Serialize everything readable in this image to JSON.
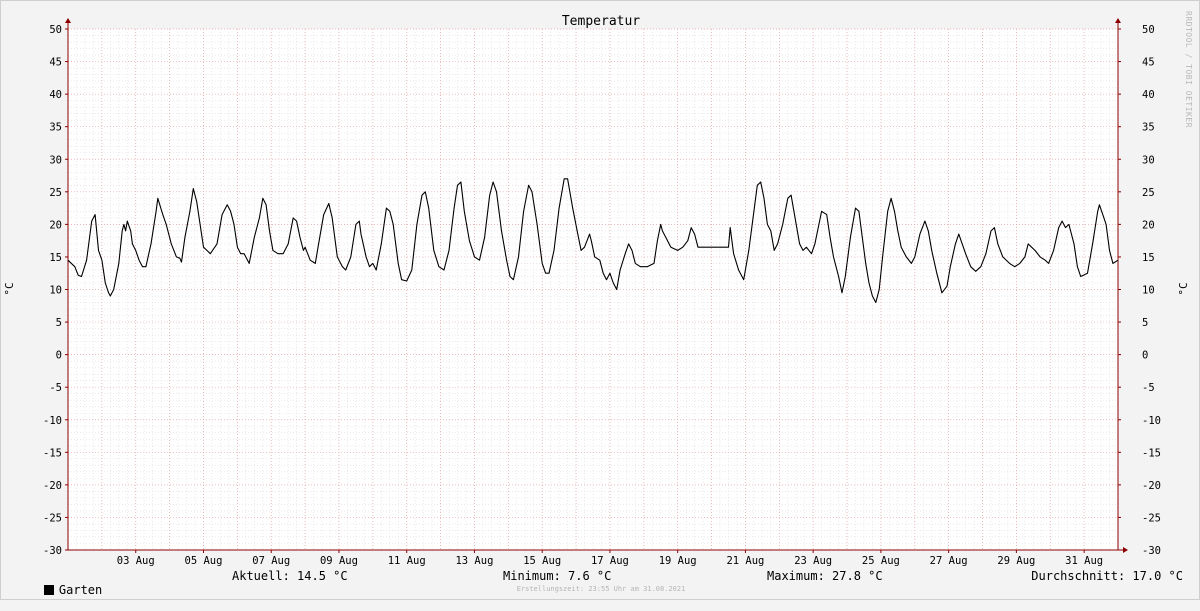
{
  "chart_data": {
    "type": "line",
    "title": "Temperatur",
    "ylabel": "°C",
    "ylabel_right": "°C",
    "ylim": [
      -30,
      50
    ],
    "y_ticks": [
      50,
      45,
      40,
      35,
      30,
      25,
      20,
      15,
      10,
      5,
      0,
      -5,
      -10,
      -15,
      -20,
      -25,
      -30
    ],
    "x_range_day": [
      1.0,
      32.0
    ],
    "x_tick_labels": [
      "03 Aug",
      "05 Aug",
      "07 Aug",
      "09 Aug",
      "11 Aug",
      "13 Aug",
      "15 Aug",
      "17 Aug",
      "19 Aug",
      "21 Aug",
      "23 Aug",
      "25 Aug",
      "27 Aug",
      "29 Aug",
      "31 Aug"
    ],
    "x_tick_days": [
      3,
      5,
      7,
      9,
      11,
      13,
      15,
      17,
      19,
      21,
      23,
      25,
      27,
      29,
      31
    ],
    "grid": true,
    "legend": "bottom-left",
    "series": [
      {
        "name": "Garten",
        "color": "#000000",
        "points": [
          [
            1.0,
            14.5
          ],
          [
            1.2,
            13.5
          ],
          [
            1.3,
            12.2
          ],
          [
            1.4,
            12.0
          ],
          [
            1.55,
            14.5
          ],
          [
            1.7,
            20.5
          ],
          [
            1.8,
            21.5
          ],
          [
            1.9,
            16.0
          ],
          [
            2.0,
            14.5
          ],
          [
            2.1,
            11.0
          ],
          [
            2.2,
            9.5
          ],
          [
            2.25,
            9.0
          ],
          [
            2.35,
            10.0
          ],
          [
            2.5,
            14.0
          ],
          [
            2.6,
            19.0
          ],
          [
            2.65,
            20.0
          ],
          [
            2.7,
            19.0
          ],
          [
            2.75,
            20.5
          ],
          [
            2.85,
            19.0
          ],
          [
            2.9,
            17.0
          ],
          [
            3.0,
            16.0
          ],
          [
            3.1,
            14.5
          ],
          [
            3.2,
            13.5
          ],
          [
            3.3,
            13.5
          ],
          [
            3.45,
            17.0
          ],
          [
            3.6,
            22.0
          ],
          [
            3.65,
            24.0
          ],
          [
            3.8,
            21.5
          ],
          [
            3.9,
            20.0
          ],
          [
            4.05,
            17.0
          ],
          [
            4.2,
            15.0
          ],
          [
            4.3,
            14.8
          ],
          [
            4.35,
            14.2
          ],
          [
            4.45,
            18.0
          ],
          [
            4.6,
            22.0
          ],
          [
            4.7,
            25.5
          ],
          [
            4.8,
            23.5
          ],
          [
            4.9,
            20.0
          ],
          [
            5.0,
            16.5
          ],
          [
            5.1,
            16.0
          ],
          [
            5.2,
            15.5
          ],
          [
            5.4,
            17.0
          ],
          [
            5.55,
            21.5
          ],
          [
            5.7,
            23.0
          ],
          [
            5.8,
            22.0
          ],
          [
            5.9,
            20.0
          ],
          [
            6.0,
            16.5
          ],
          [
            6.1,
            15.5
          ],
          [
            6.2,
            15.5
          ],
          [
            6.35,
            14.0
          ],
          [
            6.5,
            18.0
          ],
          [
            6.65,
            21.0
          ],
          [
            6.75,
            24.0
          ],
          [
            6.85,
            23.0
          ],
          [
            6.95,
            19.0
          ],
          [
            7.05,
            16.0
          ],
          [
            7.2,
            15.5
          ],
          [
            7.35,
            15.5
          ],
          [
            7.5,
            17.0
          ],
          [
            7.65,
            21.0
          ],
          [
            7.75,
            20.5
          ],
          [
            7.85,
            18.0
          ],
          [
            7.95,
            16.0
          ],
          [
            8.0,
            16.5
          ],
          [
            8.15,
            14.5
          ],
          [
            8.3,
            14.0
          ],
          [
            8.4,
            17.0
          ],
          [
            8.55,
            21.5
          ],
          [
            8.7,
            23.2
          ],
          [
            8.8,
            21.0
          ],
          [
            8.95,
            15.0
          ],
          [
            9.1,
            13.5
          ],
          [
            9.2,
            13.0
          ],
          [
            9.35,
            15.0
          ],
          [
            9.5,
            20.0
          ],
          [
            9.6,
            20.5
          ],
          [
            9.65,
            18.5
          ],
          [
            9.8,
            15.0
          ],
          [
            9.9,
            13.5
          ],
          [
            10.0,
            14.0
          ],
          [
            10.1,
            13.0
          ],
          [
            10.25,
            17.0
          ],
          [
            10.4,
            22.5
          ],
          [
            10.5,
            22.0
          ],
          [
            10.6,
            20.0
          ],
          [
            10.75,
            14.0
          ],
          [
            10.85,
            11.5
          ],
          [
            11.0,
            11.3
          ],
          [
            11.15,
            13.0
          ],
          [
            11.3,
            20.0
          ],
          [
            11.45,
            24.5
          ],
          [
            11.55,
            25.0
          ],
          [
            11.65,
            22.5
          ],
          [
            11.8,
            16.0
          ],
          [
            11.95,
            13.5
          ],
          [
            12.1,
            13.0
          ],
          [
            12.25,
            16.0
          ],
          [
            12.4,
            22.5
          ],
          [
            12.5,
            26.0
          ],
          [
            12.6,
            26.5
          ],
          [
            12.7,
            22.0
          ],
          [
            12.85,
            17.5
          ],
          [
            13.0,
            15.0
          ],
          [
            13.15,
            14.5
          ],
          [
            13.3,
            18.0
          ],
          [
            13.45,
            24.5
          ],
          [
            13.55,
            26.5
          ],
          [
            13.65,
            25.0
          ],
          [
            13.8,
            19.0
          ],
          [
            13.95,
            14.5
          ],
          [
            14.05,
            12.0
          ],
          [
            14.15,
            11.5
          ],
          [
            14.3,
            15.0
          ],
          [
            14.45,
            22.0
          ],
          [
            14.6,
            26.0
          ],
          [
            14.7,
            25.0
          ],
          [
            14.85,
            20.0
          ],
          [
            15.0,
            14.0
          ],
          [
            15.1,
            12.5
          ],
          [
            15.2,
            12.5
          ],
          [
            15.35,
            16.0
          ],
          [
            15.5,
            22.5
          ],
          [
            15.65,
            27.0
          ],
          [
            15.75,
            27.0
          ],
          [
            15.9,
            22.5
          ],
          [
            16.05,
            18.5
          ],
          [
            16.15,
            16.0
          ],
          [
            16.25,
            16.5
          ],
          [
            16.4,
            18.5
          ],
          [
            16.45,
            17.5
          ],
          [
            16.55,
            15.0
          ],
          [
            16.7,
            14.5
          ],
          [
            16.8,
            12.5
          ],
          [
            16.9,
            11.5
          ],
          [
            17.0,
            12.5
          ],
          [
            17.1,
            11.0
          ],
          [
            17.2,
            10.0
          ],
          [
            17.3,
            13.0
          ],
          [
            17.45,
            15.5
          ],
          [
            17.55,
            17.0
          ],
          [
            17.65,
            16.0
          ],
          [
            17.75,
            14.0
          ],
          [
            17.9,
            13.5
          ],
          [
            18.1,
            13.5
          ],
          [
            18.3,
            14.0
          ],
          [
            18.4,
            17.5
          ],
          [
            18.5,
            20.0
          ],
          [
            18.55,
            19.0
          ],
          [
            18.65,
            18.0
          ],
          [
            18.8,
            16.5
          ],
          [
            19.0,
            16.0
          ],
          [
            19.15,
            16.5
          ],
          [
            19.3,
            17.5
          ],
          [
            19.4,
            19.5
          ],
          [
            19.5,
            18.5
          ],
          [
            19.6,
            16.5
          ],
          [
            19.8,
            16.5
          ],
          [
            20.3,
            16.5
          ],
          [
            20.5,
            16.5
          ],
          [
            20.55,
            19.5
          ],
          [
            20.65,
            15.5
          ],
          [
            20.8,
            13.0
          ],
          [
            20.95,
            11.5
          ],
          [
            21.1,
            16.0
          ],
          [
            21.25,
            22.0
          ],
          [
            21.35,
            26.0
          ],
          [
            21.45,
            26.5
          ],
          [
            21.55,
            24.0
          ],
          [
            21.65,
            20.0
          ],
          [
            21.75,
            19.0
          ],
          [
            21.85,
            16.0
          ],
          [
            21.95,
            17.0
          ],
          [
            22.1,
            20.0
          ],
          [
            22.25,
            24.0
          ],
          [
            22.35,
            24.5
          ],
          [
            22.5,
            20.0
          ],
          [
            22.6,
            17.0
          ],
          [
            22.7,
            16.0
          ],
          [
            22.8,
            16.5
          ],
          [
            22.95,
            15.5
          ],
          [
            23.05,
            17.0
          ],
          [
            23.25,
            22.0
          ],
          [
            23.4,
            21.5
          ],
          [
            23.5,
            18.0
          ],
          [
            23.6,
            15.0
          ],
          [
            23.75,
            12.0
          ],
          [
            23.85,
            9.5
          ],
          [
            23.95,
            12.0
          ],
          [
            24.1,
            18.0
          ],
          [
            24.25,
            22.5
          ],
          [
            24.35,
            22.0
          ],
          [
            24.45,
            18.0
          ],
          [
            24.55,
            14.0
          ],
          [
            24.65,
            11.0
          ],
          [
            24.75,
            9.0
          ],
          [
            24.85,
            8.0
          ],
          [
            24.95,
            10.0
          ],
          [
            25.05,
            15.0
          ],
          [
            25.2,
            22.0
          ],
          [
            25.3,
            24.0
          ],
          [
            25.4,
            22.0
          ],
          [
            25.5,
            19.0
          ],
          [
            25.6,
            16.5
          ],
          [
            25.75,
            15.0
          ],
          [
            25.9,
            14.0
          ],
          [
            26.0,
            15.0
          ],
          [
            26.15,
            18.5
          ],
          [
            26.3,
            20.5
          ],
          [
            26.4,
            19.0
          ],
          [
            26.5,
            16.0
          ],
          [
            26.65,
            12.5
          ],
          [
            26.8,
            9.5
          ],
          [
            26.95,
            10.5
          ],
          [
            27.05,
            13.5
          ],
          [
            27.2,
            17.0
          ],
          [
            27.3,
            18.5
          ],
          [
            27.4,
            17.0
          ],
          [
            27.5,
            15.5
          ],
          [
            27.65,
            13.5
          ],
          [
            27.8,
            12.8
          ],
          [
            27.95,
            13.5
          ],
          [
            28.1,
            15.5
          ],
          [
            28.25,
            19.0
          ],
          [
            28.35,
            19.5
          ],
          [
            28.45,
            17.0
          ],
          [
            28.6,
            15.0
          ],
          [
            28.8,
            14.0
          ],
          [
            28.95,
            13.5
          ],
          [
            29.1,
            14.0
          ],
          [
            29.25,
            15.0
          ],
          [
            29.35,
            17.0
          ],
          [
            29.45,
            16.5
          ],
          [
            29.55,
            16.0
          ],
          [
            29.7,
            15.0
          ],
          [
            29.85,
            14.5
          ],
          [
            29.95,
            14.0
          ],
          [
            30.1,
            16.0
          ],
          [
            30.25,
            19.5
          ],
          [
            30.35,
            20.5
          ],
          [
            30.45,
            19.5
          ],
          [
            30.55,
            20.0
          ],
          [
            30.7,
            17.0
          ],
          [
            30.8,
            13.5
          ],
          [
            30.9,
            12.0
          ],
          [
            31.1,
            12.5
          ],
          [
            31.25,
            17.0
          ],
          [
            31.4,
            22.0
          ],
          [
            31.45,
            23.0
          ],
          [
            31.55,
            21.5
          ],
          [
            31.65,
            20.0
          ],
          [
            31.75,
            16.0
          ],
          [
            31.85,
            14.0
          ],
          [
            32.0,
            14.5
          ]
        ]
      }
    ]
  },
  "legend": {
    "series_label": "Garten",
    "series_color": "#000000",
    "aktuell": "Aktuell: 14.5 °C",
    "minimum": "Minimum: 7.6 °C",
    "maximum": "Maximum: 27.8 °C",
    "durchschnitt": "Durchschnitt: 17.0 °C"
  },
  "footer": "Erstellungszeit: 23:55 Uhr am 31.08.2021",
  "watermark": "RRDTOOL / TOBI OETIKER",
  "colors": {
    "background": "#f3f3f3",
    "plot_background": "#ffffff",
    "major_grid": "#e6a5a5",
    "minor_grid": "#dcdcdc",
    "axis": "#8c0000"
  }
}
